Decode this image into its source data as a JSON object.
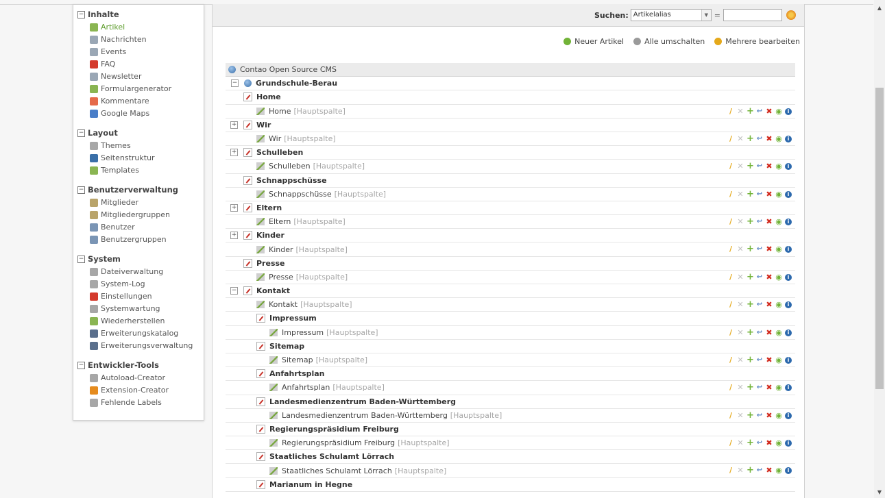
{
  "sidebar": {
    "groups": [
      {
        "title": "Inhalte",
        "items": [
          {
            "label": "Artikel",
            "icon": "article-icon",
            "color": "#8ab552",
            "active": true
          },
          {
            "label": "Nachrichten",
            "icon": "news-icon",
            "color": "#9aa7b5"
          },
          {
            "label": "Events",
            "icon": "events-icon",
            "color": "#9aa7b5"
          },
          {
            "label": "FAQ",
            "icon": "faq-icon",
            "color": "#d43a2c"
          },
          {
            "label": "Newsletter",
            "icon": "newsletter-icon",
            "color": "#9aa7b5"
          },
          {
            "label": "Formulargenerator",
            "icon": "form-icon",
            "color": "#8ab552"
          },
          {
            "label": "Kommentare",
            "icon": "comments-icon",
            "color": "#e56a4a"
          },
          {
            "label": "Google Maps",
            "icon": "google-maps-icon",
            "color": "#4a7ec8"
          }
        ]
      },
      {
        "title": "Layout",
        "items": [
          {
            "label": "Themes",
            "icon": "themes-icon",
            "color": "#a7a7a7"
          },
          {
            "label": "Seitenstruktur",
            "icon": "globe-icon",
            "color": "#3a6fa8"
          },
          {
            "label": "Templates",
            "icon": "templates-icon",
            "color": "#8ab552"
          }
        ]
      },
      {
        "title": "Benutzerverwaltung",
        "items": [
          {
            "label": "Mitglieder",
            "icon": "member-icon",
            "color": "#b9a46a"
          },
          {
            "label": "Mitgliedergruppen",
            "icon": "member-groups-icon",
            "color": "#b9a46a"
          },
          {
            "label": "Benutzer",
            "icon": "user-icon",
            "color": "#7a95b5"
          },
          {
            "label": "Benutzergruppen",
            "icon": "user-groups-icon",
            "color": "#7a95b5"
          }
        ]
      },
      {
        "title": "System",
        "items": [
          {
            "label": "Dateiverwaltung",
            "icon": "files-icon",
            "color": "#a7a7a7"
          },
          {
            "label": "System-Log",
            "icon": "log-icon",
            "color": "#a7a7a7"
          },
          {
            "label": "Einstellungen",
            "icon": "settings-icon",
            "color": "#d43a2c"
          },
          {
            "label": "Systemwartung",
            "icon": "maintenance-icon",
            "color": "#a7a7a7"
          },
          {
            "label": "Wiederherstellen",
            "icon": "restore-icon",
            "color": "#8ab552"
          },
          {
            "label": "Erweiterungskatalog",
            "icon": "catalog-icon",
            "color": "#5a6f8c"
          },
          {
            "label": "Erweiterungsverwaltung",
            "icon": "extension-manager-icon",
            "color": "#5a6f8c"
          }
        ]
      },
      {
        "title": "Entwickler-Tools",
        "items": [
          {
            "label": "Autoload-Creator",
            "icon": "autoload-icon",
            "color": "#a7a7a7"
          },
          {
            "label": "Extension-Creator",
            "icon": "extension-creator-icon",
            "color": "#e58b1e"
          },
          {
            "label": "Fehlende Labels",
            "icon": "search-icon",
            "color": "#a7a7a7"
          }
        ]
      }
    ]
  },
  "panel": {
    "search_label": "Suchen:",
    "search_field": "Artikelalias",
    "equals": "=",
    "search_value": ""
  },
  "actions": [
    {
      "label": "Neuer Artikel",
      "icon": "new-article-icon",
      "color": "#72b338"
    },
    {
      "label": "Alle umschalten",
      "icon": "toggle-all-icon",
      "color": "#9a9a9a"
    },
    {
      "label": "Mehrere bearbeiten",
      "icon": "edit-multiple-icon",
      "color": "#e5a91b"
    }
  ],
  "tree": {
    "root_label": "Contao Open Source CMS",
    "site_label": "Grundschule-Berau",
    "tag": "[Hauptspalte]",
    "rows": [
      {
        "type": "page",
        "label": "Home",
        "level": 2,
        "toggle": ""
      },
      {
        "type": "article",
        "label": "Home",
        "level": 3
      },
      {
        "type": "page",
        "label": "Wir",
        "level": 2,
        "toggle": "+"
      },
      {
        "type": "article",
        "label": "Wir",
        "level": 3
      },
      {
        "type": "page",
        "label": "Schulleben",
        "level": 2,
        "toggle": "+"
      },
      {
        "type": "article",
        "label": "Schulleben",
        "level": 3
      },
      {
        "type": "page",
        "label": "Schnappschüsse",
        "level": 2,
        "toggle": ""
      },
      {
        "type": "article",
        "label": "Schnappschüsse",
        "level": 3
      },
      {
        "type": "page",
        "label": "Eltern",
        "level": 2,
        "toggle": "+"
      },
      {
        "type": "article",
        "label": "Eltern",
        "level": 3
      },
      {
        "type": "page",
        "label": "Kinder",
        "level": 2,
        "toggle": "+"
      },
      {
        "type": "article",
        "label": "Kinder",
        "level": 3
      },
      {
        "type": "page",
        "label": "Presse",
        "level": 2,
        "toggle": ""
      },
      {
        "type": "article",
        "label": "Presse",
        "level": 3
      },
      {
        "type": "page",
        "label": "Kontakt",
        "level": 2,
        "toggle": "−"
      },
      {
        "type": "article",
        "label": "Kontakt",
        "level": 3
      },
      {
        "type": "page",
        "label": "Impressum",
        "level": 3,
        "toggle": ""
      },
      {
        "type": "article",
        "label": "Impressum",
        "level": 4
      },
      {
        "type": "page",
        "label": "Sitemap",
        "level": 3,
        "toggle": ""
      },
      {
        "type": "article",
        "label": "Sitemap",
        "level": 4
      },
      {
        "type": "page",
        "label": "Anfahrtsplan",
        "level": 3,
        "toggle": ""
      },
      {
        "type": "article",
        "label": "Anfahrtsplan",
        "level": 4
      },
      {
        "type": "page",
        "label": "Landesmedienzentrum Baden-Württemberg",
        "level": 3,
        "toggle": ""
      },
      {
        "type": "article",
        "label": "Landesmedienzentrum Baden-Württemberg",
        "level": 4
      },
      {
        "type": "page",
        "label": "Regierungspräsidium Freiburg",
        "level": 3,
        "toggle": ""
      },
      {
        "type": "article",
        "label": "Regierungspräsidium Freiburg",
        "level": 4
      },
      {
        "type": "page",
        "label": "Staatliches Schulamt Lörrach",
        "level": 3,
        "toggle": ""
      },
      {
        "type": "article",
        "label": "Staatliches Schulamt Lörrach",
        "level": 4
      },
      {
        "type": "page",
        "label": "Marianum in Hegne",
        "level": 3,
        "toggle": ""
      }
    ]
  }
}
